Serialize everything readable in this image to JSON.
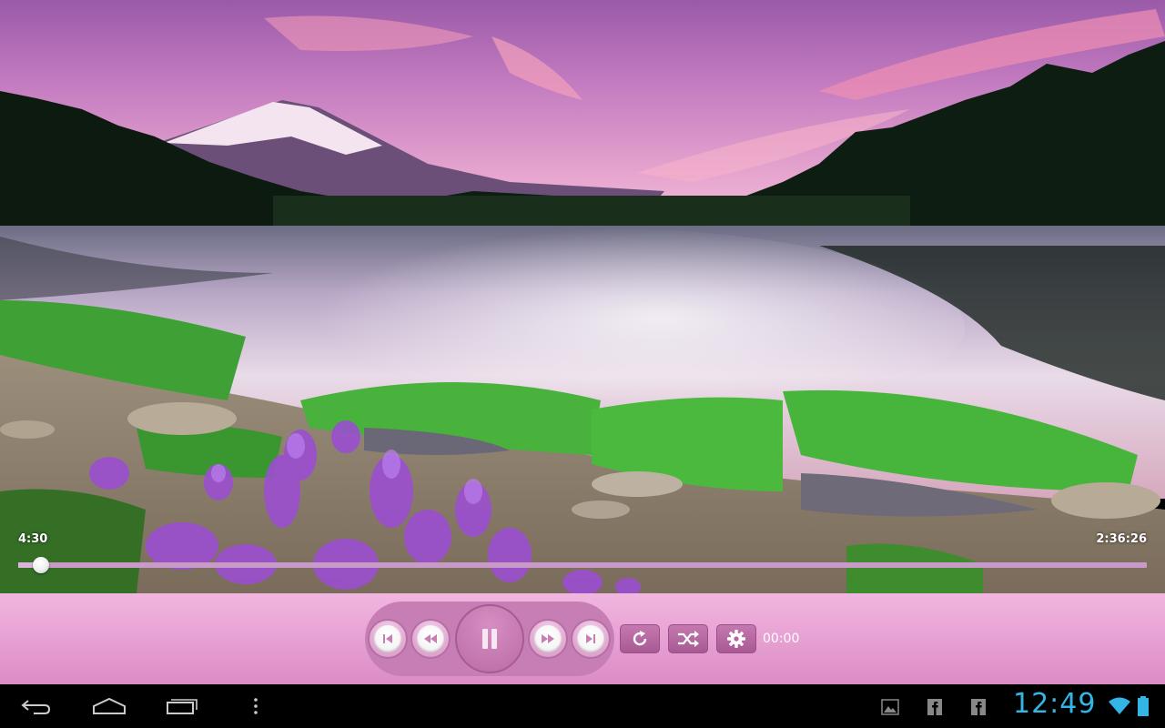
{
  "player": {
    "elapsed": "4:30",
    "duration": "2:36:26",
    "progress": 0.02,
    "control_time": "00:00",
    "colors": {
      "bar": "#e8a3d4",
      "accent": "#b96ba3"
    }
  },
  "controls": {
    "buttons": [
      {
        "name": "previous",
        "icon": "skip-previous-icon"
      },
      {
        "name": "rewind",
        "icon": "rewind-icon"
      },
      {
        "name": "pause",
        "icon": "pause-icon"
      },
      {
        "name": "fast-forward",
        "icon": "fast-forward-icon"
      },
      {
        "name": "next",
        "icon": "skip-next-icon"
      },
      {
        "name": "repeat",
        "icon": "repeat-icon"
      },
      {
        "name": "shuffle",
        "icon": "shuffle-icon"
      },
      {
        "name": "settings",
        "icon": "gear-icon"
      }
    ]
  },
  "system_bar": {
    "clock": "12:49",
    "clock_color": "#33b5e5",
    "nav_icons": [
      "back-icon",
      "home-icon",
      "recents-icon",
      "menu-icon"
    ],
    "notification_icons": [
      "gallery-icon",
      "facebook-icon",
      "facebook-icon"
    ],
    "status_icons": [
      "wifi-icon",
      "battery-icon"
    ]
  }
}
